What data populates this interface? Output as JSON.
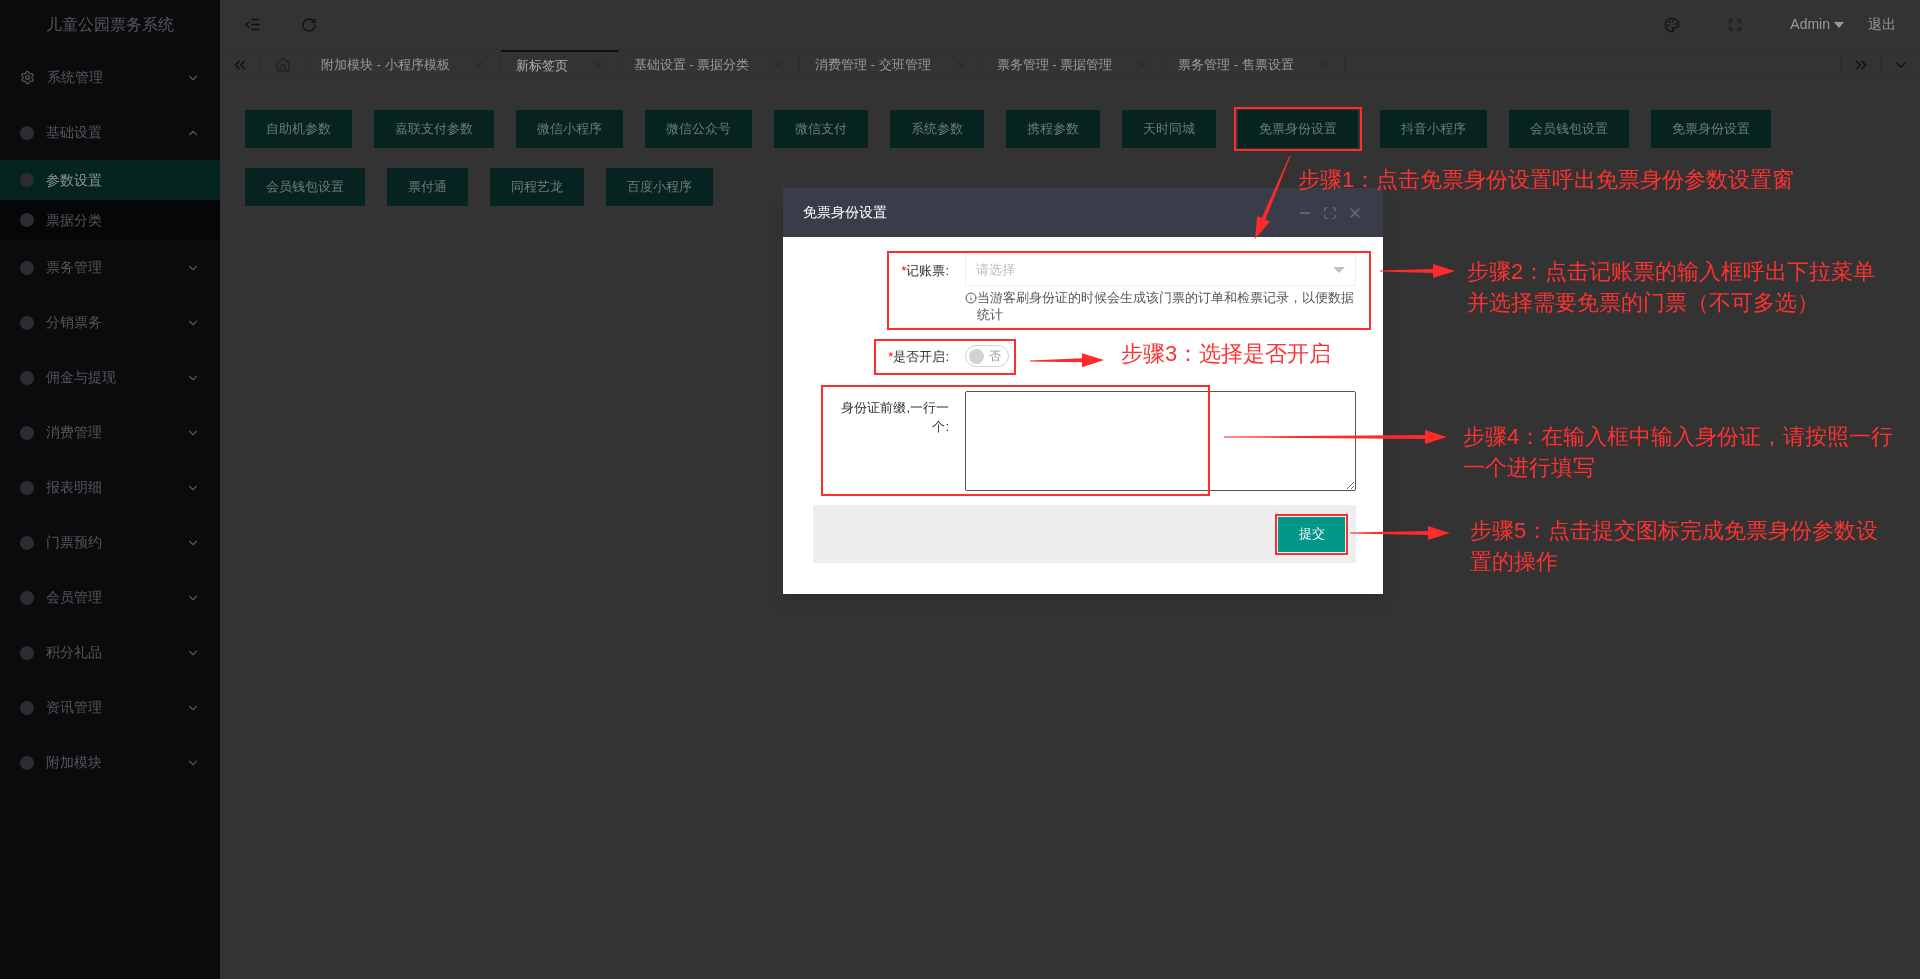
{
  "sidebar": {
    "title": "儿童公园票务系统",
    "items": [
      {
        "label": "系统管理",
        "kind": "gear",
        "expanded": false
      },
      {
        "label": "基础设置",
        "kind": "dot",
        "expanded": true,
        "children": [
          {
            "label": "参数设置",
            "selected": true
          },
          {
            "label": "票据分类",
            "selected": false
          }
        ]
      },
      {
        "label": "票务管理",
        "kind": "dot",
        "expanded": false
      },
      {
        "label": "分销票务",
        "kind": "dot",
        "expanded": false
      },
      {
        "label": "佣金与提现",
        "kind": "dot",
        "expanded": false
      },
      {
        "label": "消费管理",
        "kind": "dot",
        "expanded": false
      },
      {
        "label": "报表明细",
        "kind": "dot",
        "expanded": false
      },
      {
        "label": "门票预约",
        "kind": "dot",
        "expanded": false
      },
      {
        "label": "会员管理",
        "kind": "dot",
        "expanded": false
      },
      {
        "label": "积分礼品",
        "kind": "dot",
        "expanded": false
      },
      {
        "label": "资讯管理",
        "kind": "dot",
        "expanded": false
      },
      {
        "label": "附加模块",
        "kind": "dot",
        "expanded": false
      }
    ]
  },
  "topbar": {
    "user": "Admin",
    "logout": "退出"
  },
  "tabs": [
    {
      "label": "附加模块 - 小程序模板",
      "selected": false
    },
    {
      "label": "新标签页",
      "selected": true
    },
    {
      "label": "基础设置 - 票据分类",
      "selected": false
    },
    {
      "label": "消费管理 - 交班管理",
      "selected": false
    },
    {
      "label": "票务管理 - 票据管理",
      "selected": false
    },
    {
      "label": "票务管理 - 售票设置",
      "selected": false
    }
  ],
  "button_rows": [
    [
      {
        "label": "自助机参数",
        "highlighted": false
      },
      {
        "label": "嘉联支付参数",
        "highlighted": false
      },
      {
        "label": "微信小程序",
        "highlighted": false
      },
      {
        "label": "微信公众号",
        "highlighted": false
      },
      {
        "label": "微信支付",
        "highlighted": false
      },
      {
        "label": "系统参数",
        "highlighted": false
      },
      {
        "label": "携程参数",
        "highlighted": false
      },
      {
        "label": "天时同城",
        "highlighted": false
      },
      {
        "label": "免票身份设置",
        "highlighted": true
      },
      {
        "label": "抖音小程序",
        "highlighted": false
      },
      {
        "label": "会员钱包设置",
        "highlighted": false
      },
      {
        "label": "免票身份设置",
        "highlighted": false
      }
    ],
    [
      {
        "label": "会员钱包设置",
        "highlighted": false
      },
      {
        "label": "票付通",
        "highlighted": false
      },
      {
        "label": "同程艺龙",
        "highlighted": false
      },
      {
        "label": "百度小程序",
        "highlighted": false
      }
    ]
  ],
  "dialog": {
    "title": "免票身份设置",
    "fields": [
      {
        "kind": "select",
        "label": "记账票:",
        "required_mark": "*",
        "placeholder": "请选择",
        "hint": "当游客刷身份证的时候会生成该门票的订单和检票记录，以便数据统计"
      },
      {
        "kind": "switch",
        "label": "是否开启:",
        "required_mark": "*",
        "on": false,
        "text": "否"
      },
      {
        "kind": "textarea",
        "label": "身份证前缀,一行一个:"
      }
    ],
    "submit": "提交"
  },
  "annotations": [
    "步骤1：点击免票身份设置呼出免票身份参数设置窗",
    "步骤2：点击记账票的输入框呼出下拉菜单并选择需要免票的门票（不可多选）",
    "步骤3：选择是否开启",
    "步骤4：在输入框中输入身份证，请按照一行一个进行填写",
    "步骤5：点击提交图标完成免票身份参数设置的操作"
  ]
}
